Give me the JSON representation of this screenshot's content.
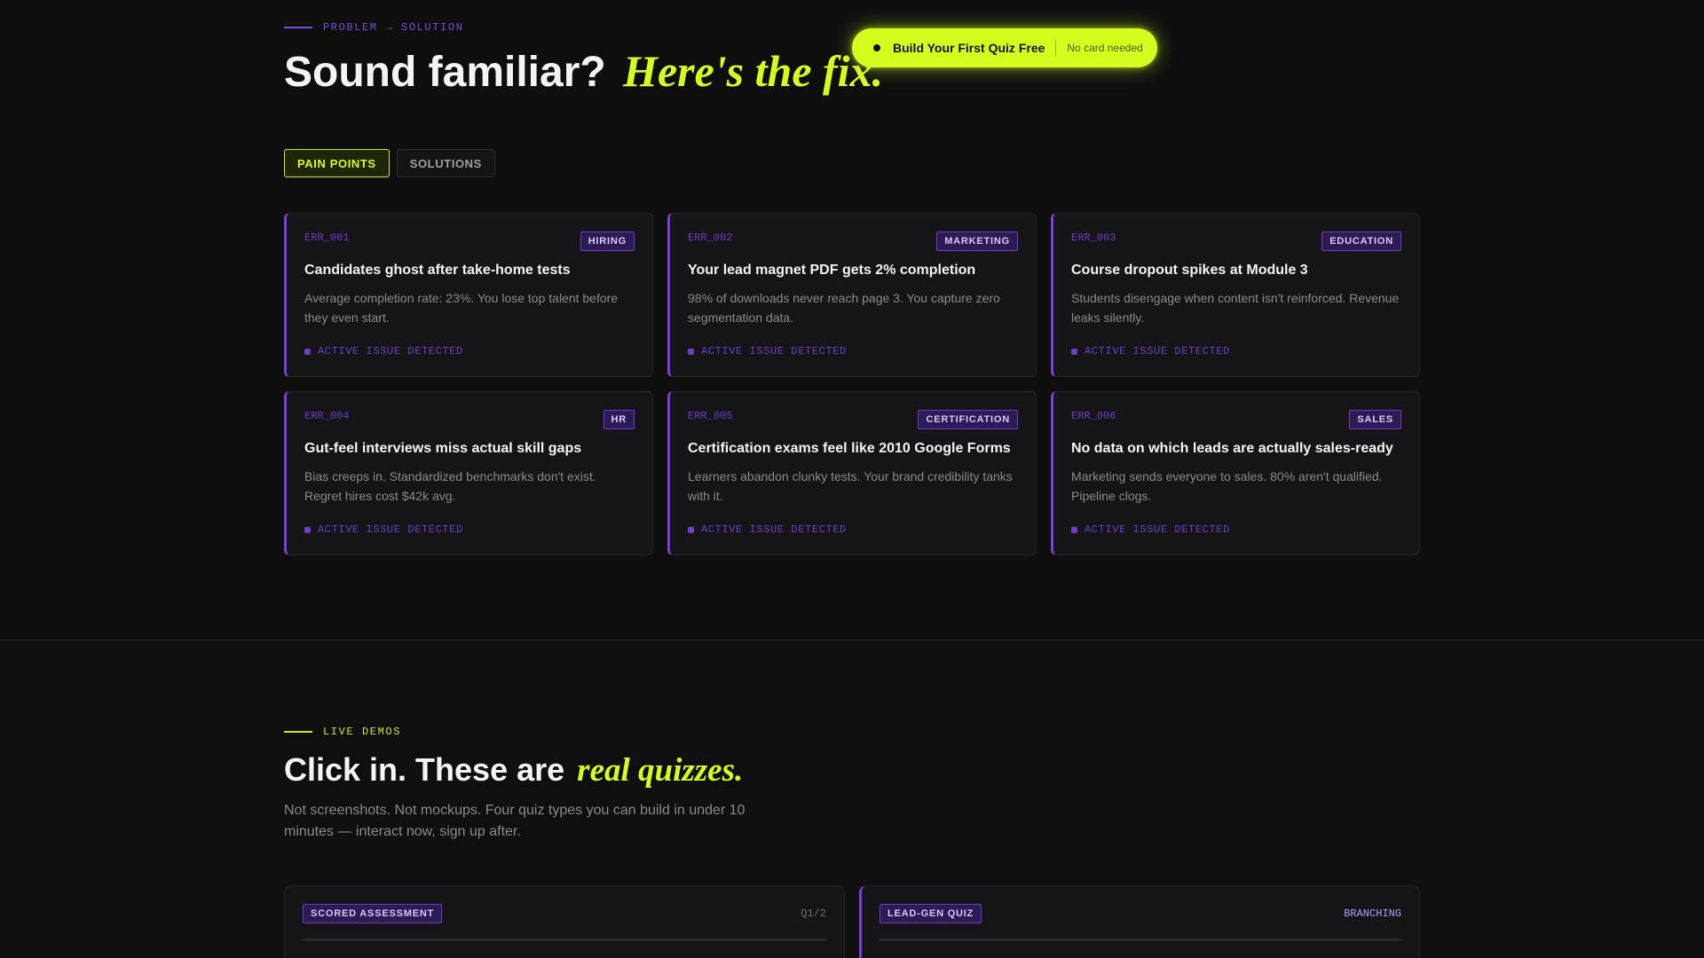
{
  "problem_section": {
    "eyebrow": "PROBLEM → SOLUTION",
    "headline_main": "Sound familiar?",
    "headline_accent": "Here's the fix.",
    "tabs": [
      {
        "label": "PAIN POINTS",
        "active": true
      },
      {
        "label": "SOLUTIONS",
        "active": false
      }
    ],
    "cards": [
      {
        "code": "ERR_001",
        "tag": "HIRING",
        "title": "Candidates ghost after take-home tests",
        "desc": "Average completion rate: 23%. You lose top talent before they even start.",
        "status": "ACTIVE ISSUE DETECTED"
      },
      {
        "code": "ERR_002",
        "tag": "MARKETING",
        "title": "Your lead magnet PDF gets 2% completion",
        "desc": "98% of downloads never reach page 3. You capture zero segmentation data.",
        "status": "ACTIVE ISSUE DETECTED"
      },
      {
        "code": "ERR_003",
        "tag": "EDUCATION",
        "title": "Course dropout spikes at Module 3",
        "desc": "Students disengage when content isn't reinforced. Revenue leaks silently.",
        "status": "ACTIVE ISSUE DETECTED"
      },
      {
        "code": "ERR_004",
        "tag": "HR",
        "title": "Gut-feel interviews miss actual skill gaps",
        "desc": "Bias creeps in. Standardized benchmarks don't exist. Regret hires cost $42k avg.",
        "status": "ACTIVE ISSUE DETECTED"
      },
      {
        "code": "ERR_005",
        "tag": "CERTIFICATION",
        "title": "Certification exams feel like 2010 Google Forms",
        "desc": "Learners abandon clunky tests. Your brand credibility tanks with it.",
        "status": "ACTIVE ISSUE DETECTED"
      },
      {
        "code": "ERR_006",
        "tag": "SALES",
        "title": "No data on which leads are actually sales-ready",
        "desc": "Marketing sends everyone to sales. 80% aren't qualified. Pipeline clogs.",
        "status": "ACTIVE ISSUE DETECTED"
      }
    ]
  },
  "cta": {
    "label": "Build Your First Quiz Free",
    "note": "No card needed"
  },
  "demos_section": {
    "eyebrow": "LIVE DEMOS",
    "headline_main": "Click in. These are",
    "headline_accent": "real quizzes.",
    "subtext": "Not screenshots. Not mockups. Four quiz types you can build in under 10 minutes — interact now, sign up after.",
    "demos": [
      {
        "badge": "SCORED ASSESSMENT",
        "meta": "Q1/2"
      },
      {
        "badge": "LEAD-GEN QUIZ",
        "meta": "BRANCHING"
      }
    ]
  },
  "colors": {
    "accent_lime": "#d4ff1e",
    "accent_purple": "#7a3fe0",
    "background": "#0e0e0f"
  }
}
